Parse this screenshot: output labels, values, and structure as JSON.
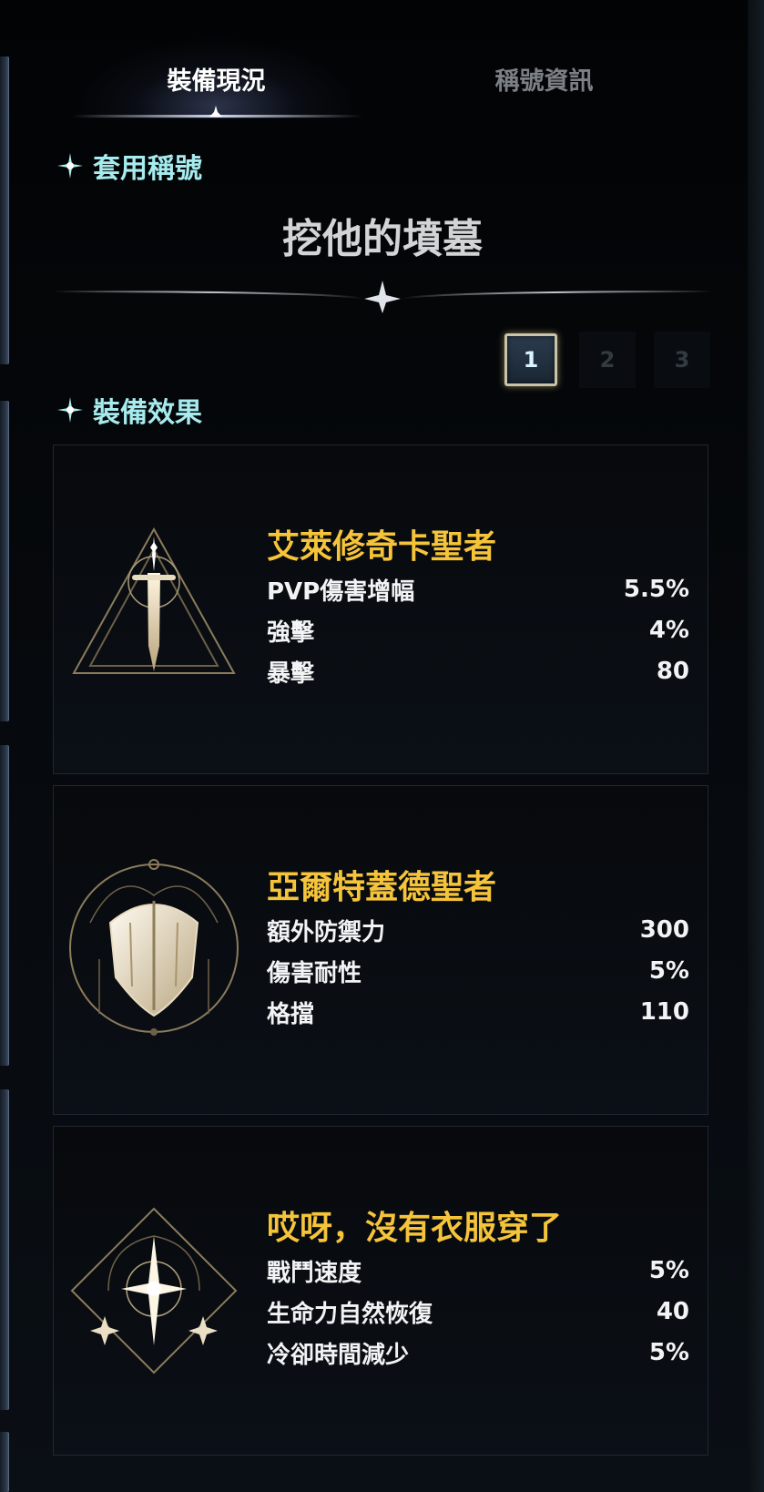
{
  "tabs": [
    {
      "label": "裝備現況",
      "active": true
    },
    {
      "label": "稱號資訊",
      "active": false
    }
  ],
  "applied_title": {
    "header": "套用稱號",
    "name": "挖他的墳墓"
  },
  "pages": [
    "1",
    "2",
    "3"
  ],
  "selected_page": "1",
  "effects": {
    "header": "裝備效果",
    "cards": [
      {
        "title": "艾萊修奇卡聖者",
        "icon": "sword-triangle-icon",
        "stats": [
          {
            "name": "PVP傷害增幅",
            "value": "5.5%"
          },
          {
            "name": "強擊",
            "value": "4%"
          },
          {
            "name": "暴擊",
            "value": "80"
          }
        ]
      },
      {
        "title": "亞爾特蓋德聖者",
        "icon": "shield-circle-icon",
        "stats": [
          {
            "name": "額外防禦力",
            "value": "300"
          },
          {
            "name": "傷害耐性",
            "value": "5%"
          },
          {
            "name": "格擋",
            "value": "110"
          }
        ]
      },
      {
        "title": "哎呀，沒有衣服穿了",
        "icon": "star-diamond-icon",
        "stats": [
          {
            "name": "戰鬥速度",
            "value": "5%"
          },
          {
            "name": "生命力自然恢復",
            "value": "40"
          },
          {
            "name": "冷卻時間減少",
            "value": "5%"
          }
        ]
      }
    ]
  },
  "colors": {
    "accent_cyan": "#a6ebee",
    "title_gold": "#f5c43a",
    "background": "#05080c"
  }
}
